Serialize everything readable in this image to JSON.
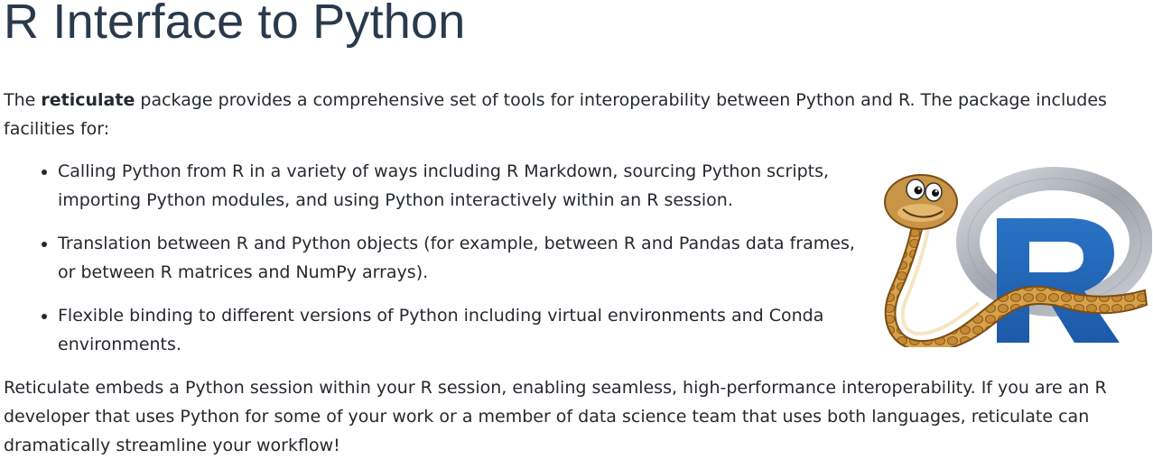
{
  "page": {
    "title": "R Interface to Python"
  },
  "intro": {
    "before": "The ",
    "bold": "reticulate",
    "after": " package provides a comprehensive set of tools for interoperability between Python and R. The package includes facilities for:"
  },
  "features": [
    "Calling Python from R in a variety of ways including R Markdown, sourcing Python scripts, importing Python modules, and using Python interactively within an R session.",
    "Translation between R and Python objects (for example, between R and Pandas data frames, or between R matrices and NumPy arrays).",
    "Flexible binding to different versions of Python including virtual environments and Conda environments."
  ],
  "outro": "Reticulate embeds a Python session within your R session, enabling seamless, high-performance interoperability. If you are an R developer that uses Python for some of your work or a member of data science team that uses both languages, reticulate can dramatically streamline your workflow!",
  "logo": {
    "name": "reticulate-snake-r-logo",
    "r_letter": "R",
    "colors": {
      "r_blue": "#1f65b7",
      "ring_gray": "#b8bcc4",
      "snake_tan": "#d9a64c",
      "snake_dark": "#8a5a1c"
    }
  }
}
